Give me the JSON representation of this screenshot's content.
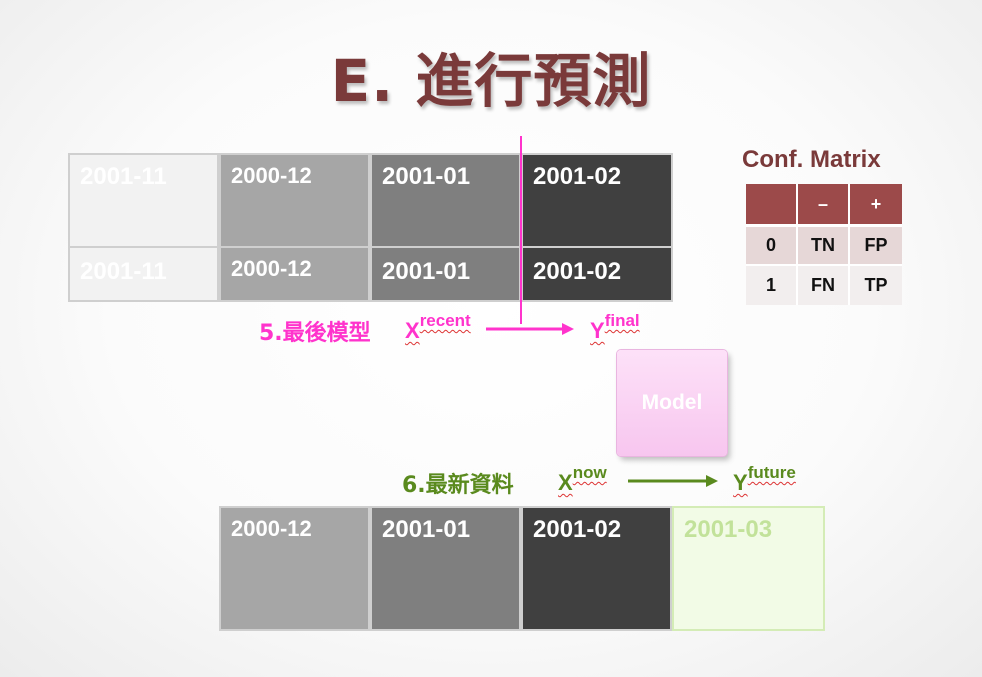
{
  "title": "E. 進行預測",
  "top_table": {
    "rows": [
      [
        "2001-11",
        "2000-12",
        "2001-01",
        "2001-02"
      ],
      [
        "2001-11",
        "2000-12",
        "2001-01",
        "2001-02"
      ]
    ]
  },
  "step5": {
    "label": "5.最後模型",
    "x_base": "X",
    "x_sup": "recent",
    "y_base": "Y",
    "y_sup": "final",
    "color": "#ff33cc"
  },
  "model": {
    "label": "Model"
  },
  "step6": {
    "label": "6.最新資料",
    "x_base": "X",
    "x_sup": "now",
    "y_base": "Y",
    "y_sup": "future",
    "color": "#5a8a1e"
  },
  "bottom_table": {
    "cells": [
      "2000-12",
      "2001-01",
      "2001-02",
      "2001-03"
    ]
  },
  "conf_matrix": {
    "title": "Conf. Matrix",
    "header": [
      "",
      "–",
      "+"
    ],
    "rows": [
      [
        "0",
        "TN",
        "FP"
      ],
      [
        "1",
        "FN",
        "TP"
      ]
    ]
  }
}
